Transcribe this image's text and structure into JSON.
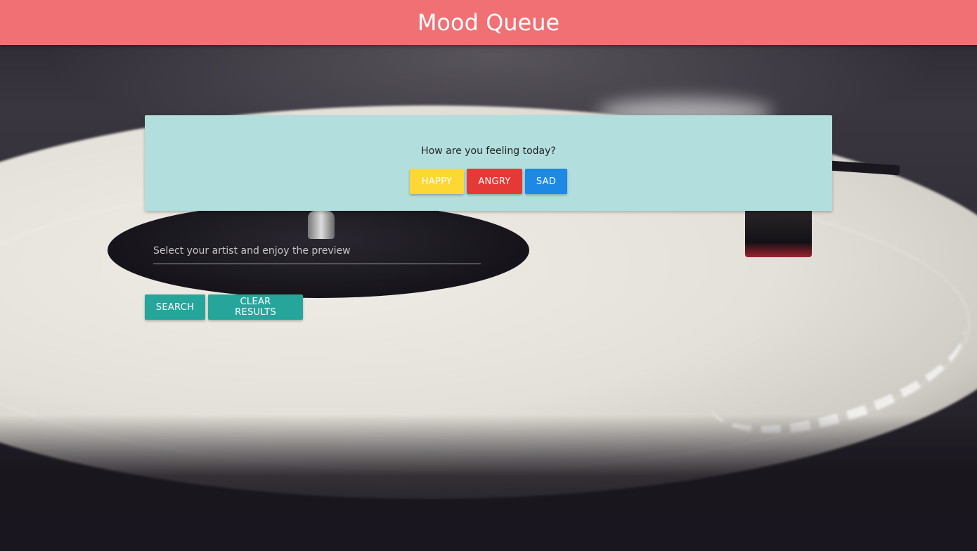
{
  "header": {
    "title": "Mood Queue",
    "color": "#f07074"
  },
  "mood_card": {
    "question": "How are you feeling today?",
    "background": "#b2dfdd",
    "buttons": [
      {
        "label": "HAPPY",
        "color": "#fdd835"
      },
      {
        "label": "ANGRY",
        "color": "#e53935"
      },
      {
        "label": "SAD",
        "color": "#1e88e5"
      }
    ]
  },
  "search": {
    "placeholder": "Select your artist and enjoy the preview",
    "value": ""
  },
  "actions": {
    "search_label": "SEARCH",
    "clear_label": "CLEAR RESULTS",
    "color": "#26a69a"
  },
  "background": {
    "description_icon": "turntable-background-image"
  }
}
